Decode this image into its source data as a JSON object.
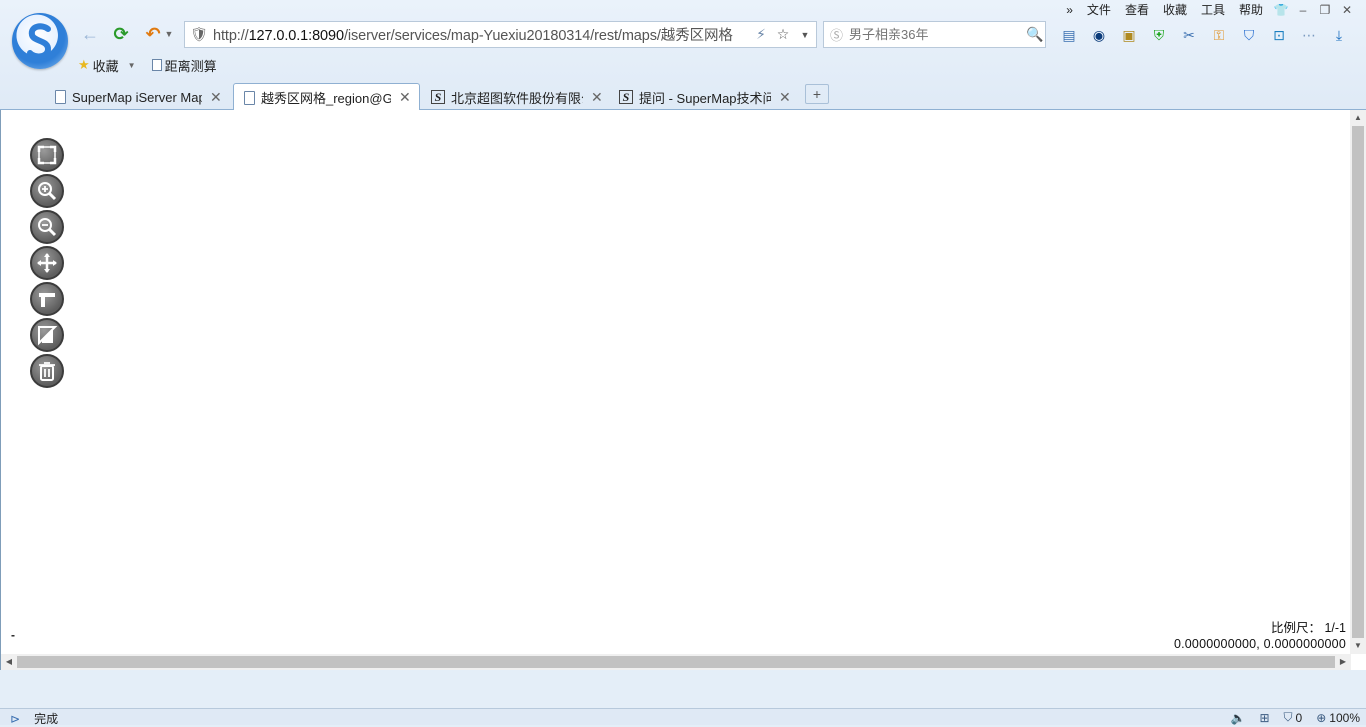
{
  "menu": {
    "more_icon": "double-chevron-right-icon",
    "items": [
      "文件",
      "查看",
      "收藏",
      "工具",
      "帮助"
    ]
  },
  "address": {
    "url_prefix": "http://",
    "url_host": "127.0.0.1:8090",
    "url_path": "/iserver/services/map-Yuexiu20180314/rest/maps/越秀区网格"
  },
  "search": {
    "placeholder": "男子相亲36年"
  },
  "favorites": {
    "collect_label": "收藏",
    "item_label": "距离测算"
  },
  "tabs": [
    {
      "title": "SuperMap iServer Map",
      "icon": "page"
    },
    {
      "title": "越秀区网格_region@Guangzhou",
      "icon": "page",
      "active": true
    },
    {
      "title": "北京超图软件股份有限公司",
      "icon": "S"
    },
    {
      "title": "提问 - SuperMap技术问答",
      "icon": "S"
    }
  ],
  "newtab_label": "+",
  "map": {
    "scale_label": "比例尺：",
    "scale_value": "1/-1",
    "coords": "0.0000000000, 0.0000000000",
    "dash": "-"
  },
  "status": {
    "text": "完成",
    "count": "0",
    "zoom": "100%"
  }
}
